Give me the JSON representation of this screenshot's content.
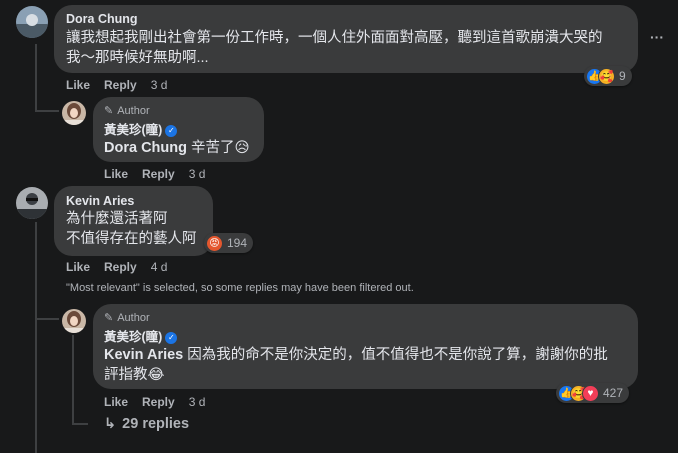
{
  "comments": [
    {
      "author": "Dora Chung",
      "text_line1": "讓我想起我剛出社會第一份工作時，一個人住外面面對高壓，聽到這首歌崩潰大哭的",
      "text_line2": "我～那時候好無助啊...",
      "like": "Like",
      "reply": "Reply",
      "time": "3 d",
      "reactions": [
        "like-icon",
        "care-icon"
      ],
      "reaction_count": "9",
      "more": "···"
    },
    {
      "author_tag": "Author",
      "author": "黃美珍(瞳)",
      "mention": "Dora Chung",
      "text": " 辛苦了",
      "emoji": "😥",
      "like": "Like",
      "reply": "Reply",
      "time": "3 d"
    },
    {
      "author": "Kevin Aries",
      "text_line1": "為什麼還活著阿",
      "text_line2": "不值得存在的藝人阿",
      "like": "Like",
      "reply": "Reply",
      "time": "4 d",
      "reactions": [
        "angry-icon"
      ],
      "reaction_count": "194"
    },
    {
      "author_tag": "Author",
      "author": "黃美珍(瞳)",
      "mention": "Kevin Aries",
      "text_line1": " 因為我的命不是你決定的，值不值得也不是你說了算，謝謝你的批",
      "text_line2": "評指教",
      "emoji": "😂",
      "like": "Like",
      "reply": "Reply",
      "time": "3 d",
      "reactions": [
        "like-icon",
        "care-icon",
        "love-icon"
      ],
      "reaction_count": "427"
    }
  ],
  "filter_notice": "\"Most relevant\" is selected, so some replies may have been filtered out.",
  "view_replies": "29 replies",
  "colors": {
    "bg": "#18191a",
    "bubble": "#3a3b3c",
    "text": "#e4e6eb",
    "muted": "#b0b3b8",
    "like_blue": "#1877f2"
  }
}
